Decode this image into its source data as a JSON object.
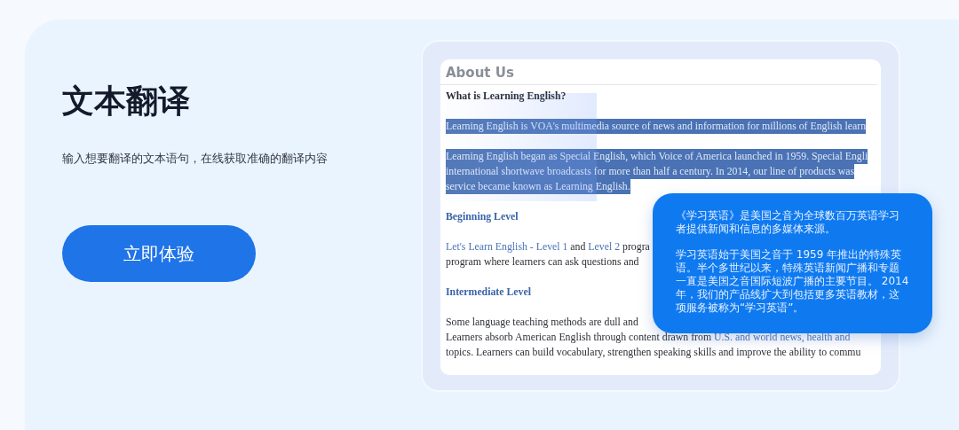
{
  "feature": {
    "title": "文本翻译",
    "description": "输入想要翻译的文本语句，在线获取准确的翻译内容",
    "button": "立即体验"
  },
  "document": {
    "title": "About Us",
    "blocks": [
      {
        "kind": "question",
        "text": "What is Learning English?"
      },
      {
        "kind": "paragraph",
        "selected": true,
        "lines": [
          [
            {
              "text": "Learning English is VOA's multimedia source of news and information for millions of English learn",
              "kind": "text"
            }
          ]
        ]
      },
      {
        "kind": "paragraph",
        "selected": true,
        "lines": [
          [
            {
              "text": "Learning English began as Special English, which Voice of America launched in 1959. Special Engli",
              "kind": "text"
            }
          ],
          [
            {
              "text": "international shortwave broadcasts for more than half a century. In 2014, our line of products was",
              "kind": "text"
            }
          ],
          [
            {
              "text": "service became known as Learning English.",
              "kind": "text"
            }
          ]
        ]
      },
      {
        "kind": "heading",
        "text": "Beginning Level"
      },
      {
        "kind": "paragraph",
        "selected": false,
        "lines": [
          [
            {
              "text": "Let's Learn English - Level 1",
              "kind": "link"
            },
            {
              "text": " and ",
              "kind": "text"
            },
            {
              "text": "Level 2",
              "kind": "link"
            },
            {
              "text": " progra",
              "kind": "text"
            }
          ],
          [
            {
              "text": "program where learners can ask questions and",
              "kind": "text"
            }
          ]
        ]
      },
      {
        "kind": "heading",
        "text": "Intermediate Level"
      },
      {
        "kind": "paragraph",
        "selected": false,
        "lines": [
          [
            {
              "text": "Some language teaching methods are dull and",
              "kind": "text"
            }
          ],
          [
            {
              "text": "Learners absorb American English through content drawn from ",
              "kind": "text"
            },
            {
              "text": "U.S. and world news, health and",
              "kind": "link"
            }
          ],
          [
            {
              "text": "topics. Learners can build vocabulary, strengthen speaking skills and improve the ability to commu",
              "kind": "text"
            }
          ]
        ]
      }
    ]
  },
  "translation": {
    "paragraphs": [
      "《学习英语》是美国之音为全球数百万英语学习者提供新闻和信息的多媒体来源。",
      "学习英语始于美国之音于 1959 年推出的特殊英语。半个多世纪以来，特殊英语新闻广播和专题一直是美国之音国际短波广播的主要节目。 2014年，我们的产品线扩大到包括更多英语教材，这项服务被称为“学习英语”。"
    ]
  }
}
